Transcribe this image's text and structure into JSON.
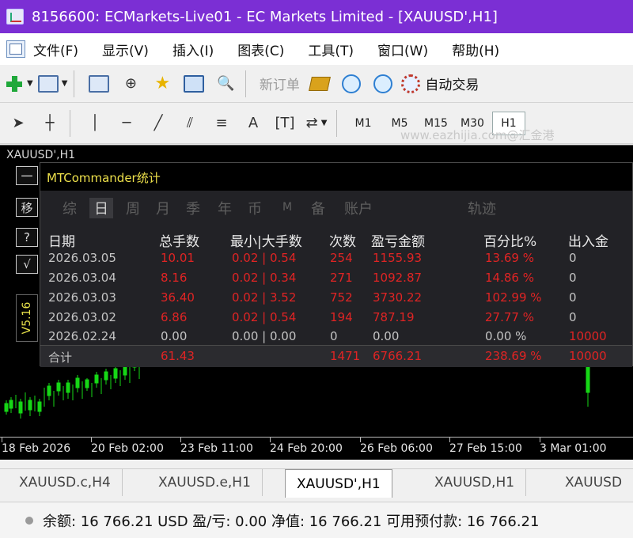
{
  "window": {
    "title": "8156600: ECMarkets-Live01 - EC Markets Limited - [XAUUSD',H1]"
  },
  "menu": [
    "文件(F)",
    "显示(V)",
    "插入(I)",
    "图表(C)",
    "工具(T)",
    "窗口(W)",
    "帮助(H)"
  ],
  "toolbar": {
    "new_order": "新订单",
    "auto_trading": "自动交易"
  },
  "timeframes": [
    "M1",
    "M5",
    "M15",
    "M30",
    "H1"
  ],
  "selected_timeframe": "H1",
  "watermark": "www.eazhijia.com@汇金港",
  "chart": {
    "symbol_label": "XAUUSD',H1",
    "version": "V5.16",
    "x_labels": [
      "18 Feb 2026",
      "20 Feb 02:00",
      "23 Feb 11:00",
      "24 Feb 20:00",
      "26 Feb 06:00",
      "27 Feb 15:00",
      "3 Mar 01:00"
    ],
    "side_buttons": [
      "一",
      "移",
      "?",
      "√"
    ]
  },
  "panel": {
    "title": "MTCommander统计",
    "tabs": [
      "综",
      "日",
      "周",
      "月",
      "季",
      "年",
      "币",
      "M",
      "备",
      "账户",
      "轨迹"
    ],
    "active_tab": "日",
    "columns": [
      "日期",
      "总手数",
      "最小|大手数",
      "次数",
      "盈亏金额",
      "百分比%",
      "出入金"
    ],
    "rows": [
      [
        "2026.03.05",
        "10.01",
        "0.02 | 0.54",
        "254",
        "1155.93",
        "13.69 %",
        "0"
      ],
      [
        "2026.03.04",
        "8.16",
        "0.02 | 0.34",
        "271",
        "1092.87",
        "14.86 %",
        "0"
      ],
      [
        "2026.03.03",
        "36.40",
        "0.02 | 3.52",
        "752",
        "3730.22",
        "102.99 %",
        "0"
      ],
      [
        "2026.03.02",
        "6.86",
        "0.02 | 0.54",
        "194",
        "787.19",
        "27.77 %",
        "0"
      ],
      [
        "2026.02.24",
        "0.00",
        "0.00 | 0.00",
        "0",
        "0.00",
        "0.00 %",
        "10000"
      ]
    ],
    "total": [
      "合计",
      "61.43",
      "",
      "1471",
      "6766.21",
      "238.69 %",
      "10000"
    ]
  },
  "chart_tabs": [
    "XAUUSD.c,H4",
    "XAUUSD.e,H1",
    "XAUUSD',H1",
    "XAUUSD,H1",
    "XAUUSD"
  ],
  "active_chart_tab": "XAUUSD',H1",
  "status": {
    "text": "余额: 16 766.21 USD  盈/亏: 0.00  净值: 16 766.21  可用预付款: 16 766.21"
  }
}
